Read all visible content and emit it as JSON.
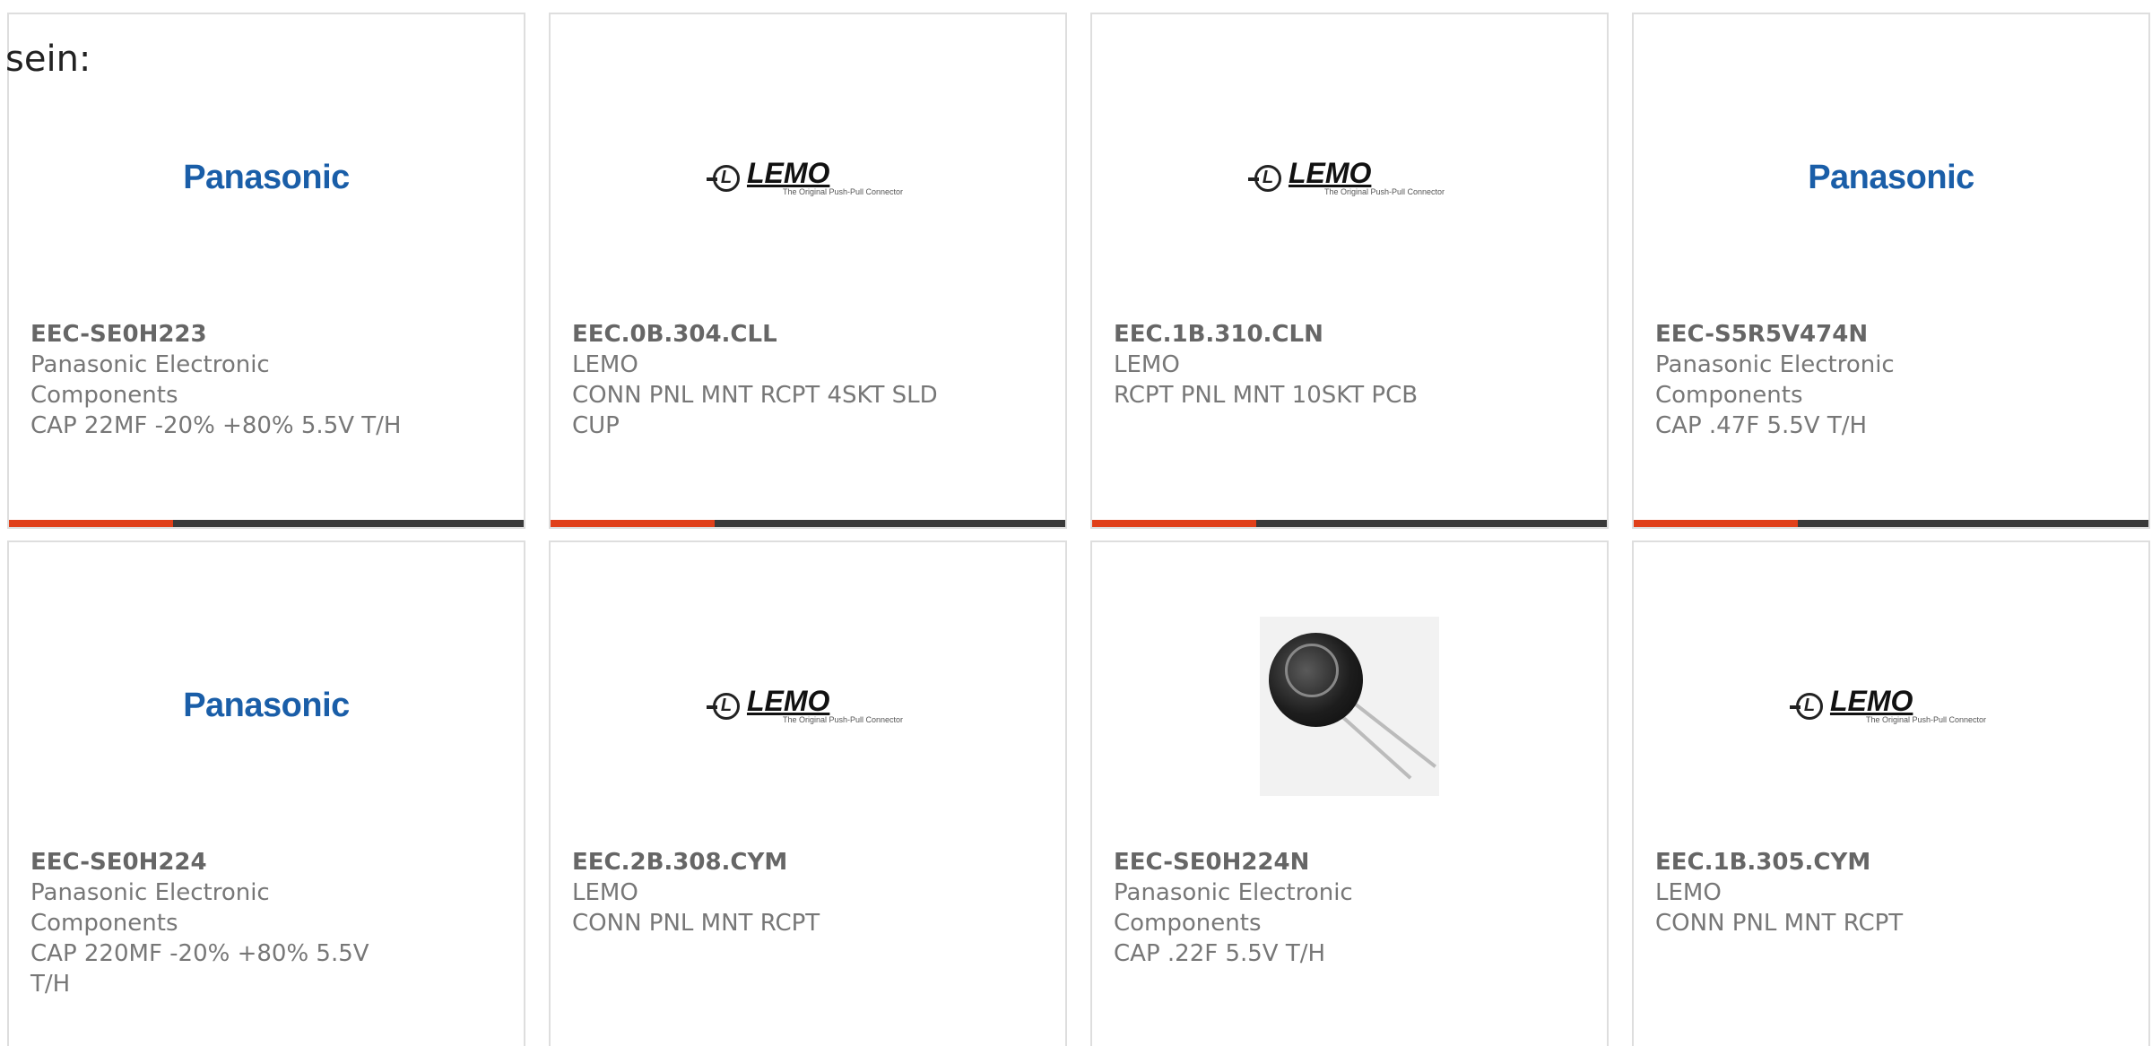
{
  "header": {
    "label": "sein:"
  },
  "colors": {
    "accent": "#e0401a",
    "bar": "#3a3a3a"
  },
  "cards": [
    {
      "part": "EEC-SE0H223",
      "manufacturer": "Panasonic Electronic Components",
      "description": "CAP 22MF -20% +80% 5.5V T/H",
      "logo": "Panasonic"
    },
    {
      "part": "EEC.0B.304.CLL",
      "manufacturer": "LEMO",
      "description": "CONN PNL MNT RCPT 4SKT SLD CUP",
      "logo": "LEMO"
    },
    {
      "part": "EEC.1B.310.CLN",
      "manufacturer": "LEMO",
      "description": "RCPT PNL MNT 10SKT PCB",
      "logo": "LEMO"
    },
    {
      "part": "EEC-S5R5V474N",
      "manufacturer": "Panasonic Electronic Components",
      "description": "CAP .47F 5.5V T/H",
      "logo": "Panasonic"
    },
    {
      "part": "EEC-SE0H224",
      "manufacturer": "Panasonic Electronic Components",
      "description": "CAP 220MF -20% +80% 5.5V T/H",
      "logo": "Panasonic"
    },
    {
      "part": "EEC.2B.308.CYM",
      "manufacturer": "LEMO",
      "description": "CONN PNL MNT RCPT",
      "logo": "LEMO"
    },
    {
      "part": "EEC-SE0H224N",
      "manufacturer": "Panasonic Electronic Components",
      "description": "CAP .22F 5.5V T/H",
      "logo": "photo"
    },
    {
      "part": "EEC.1B.305.CYM",
      "manufacturer": "LEMO",
      "description": "CONN PNL MNT RCPT",
      "logo": "LEMO"
    }
  ],
  "logos": {
    "panasonic": "Panasonic",
    "lemo_name": "LEMO",
    "lemo_letter": "L",
    "lemo_tag": "The Original Push-Pull Connector"
  }
}
